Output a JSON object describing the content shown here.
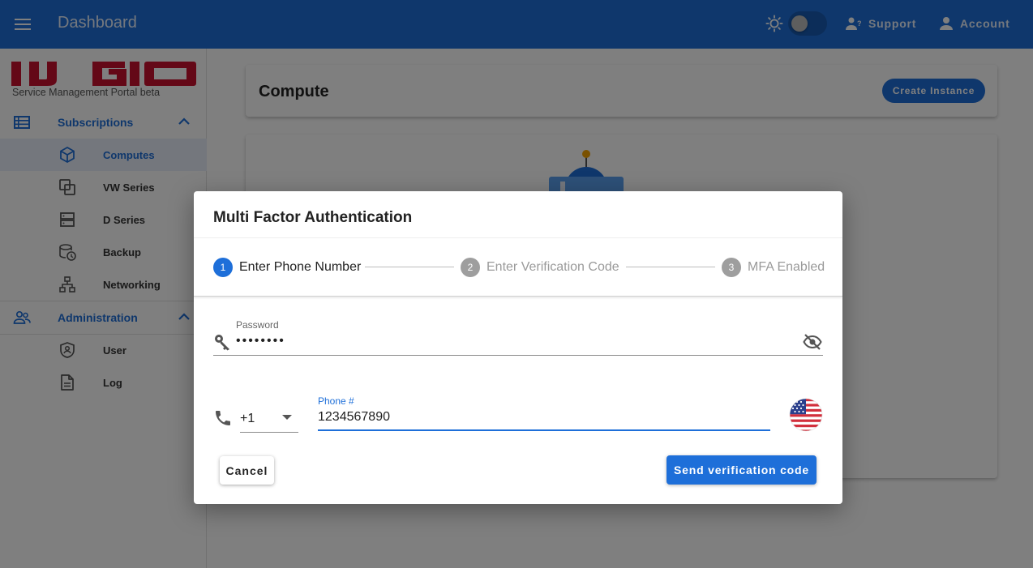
{
  "appbar": {
    "title": "Dashboard",
    "support_label": "Support",
    "account_label": "Account",
    "color": "#1e6fd9"
  },
  "sidebar": {
    "logo_text": "IIJ GIO",
    "logo_subtitle": "Service Management Portal beta",
    "logo_color": "#c8102e",
    "groups": [
      {
        "label": "Subscriptions",
        "icon": "list-icon",
        "items": [
          {
            "label": "Computes",
            "icon": "cube-icon",
            "active": true
          },
          {
            "label": "VW Series",
            "icon": "copy-icon"
          },
          {
            "label": "D Series",
            "icon": "server-icon"
          },
          {
            "label": "Backup",
            "icon": "database-clock-icon"
          },
          {
            "label": "Networking",
            "icon": "network-icon"
          }
        ]
      },
      {
        "label": "Administration",
        "icon": "people-icon",
        "items": [
          {
            "label": "User",
            "icon": "shield-user-icon"
          },
          {
            "label": "Log",
            "icon": "document-icon"
          }
        ]
      }
    ]
  },
  "main": {
    "title": "Compute",
    "create_label": "Create Instance"
  },
  "dialog": {
    "title": "Multi Factor Authentication",
    "steps": [
      {
        "number": "1",
        "label": "Enter Phone Number",
        "active": true
      },
      {
        "number": "2",
        "label": "Enter Verification Code",
        "active": false
      },
      {
        "number": "3",
        "label": "MFA Enabled",
        "active": false
      }
    ],
    "password": {
      "label": "Password",
      "value": "••••••••"
    },
    "country_code": "+1",
    "phone": {
      "label": "Phone #",
      "value": "1234567890"
    },
    "cancel_label": "Cancel",
    "send_label": "Send verification code"
  }
}
